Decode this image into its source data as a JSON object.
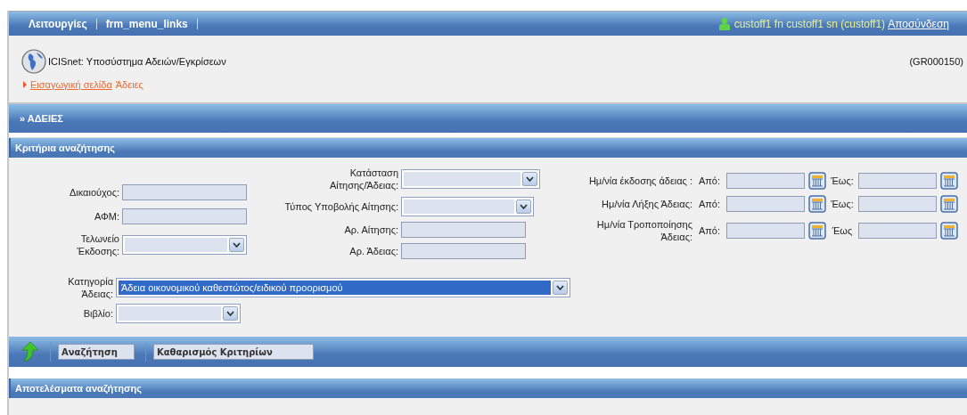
{
  "top_bar": {
    "menu": [
      "Λειτουργίες",
      "frm_menu_links"
    ],
    "user": "custoff1 fn custoff1 sn (custoff1)",
    "logout": "Αποσύνδεση"
  },
  "header": {
    "title": "ICISnet: Υποσύστημα Αδειών/Εγκρίσεων",
    "code": "(GR000150)",
    "breadcrumb": [
      "Εισαγωγική σελίδα",
      "Άδειες"
    ]
  },
  "section": {
    "chevron": "»",
    "title": "ΑΔΕΙΕΣ"
  },
  "criteria": {
    "title": "Κριτήρια αναζήτησης",
    "column_1": [
      {
        "label": "Δικαιούχος:",
        "kind": "text"
      },
      {
        "label": "ΑΦΜ:",
        "kind": "text"
      },
      {
        "label": "Τελωνείο\nΈκδοσης:",
        "kind": "select"
      }
    ],
    "column_2": [
      {
        "label": "Κατάσταση\nΑίτησης/Άδειας:",
        "kind": "select"
      },
      {
        "label": "Τύπος Υποβολής Αίτησης:",
        "kind": "select"
      },
      {
        "label": "Αρ. Αίτησης:",
        "kind": "text"
      },
      {
        "label": "Αρ. Άδειας:",
        "kind": "text"
      }
    ],
    "date_ranges": [
      {
        "label": "Ημ/νία έκδοσης άδειας :",
        "from_label": "Από:",
        "to_label": "Έως:"
      },
      {
        "label": "Ημ/νία Λήξης Άδειας:",
        "from_label": "Από:",
        "to_label": "Έως:"
      },
      {
        "label": "Ημ/νία Τροποποίησης\nΆδειας:",
        "from_label": "Από:",
        "to_label": "Έως"
      }
    ],
    "bottom": [
      {
        "label": "Κατηγορία\nΆδειας:",
        "kind": "select",
        "value": "Άδεια οικονομικού καθεστώτος/ειδικού προορισμού",
        "highlighted": true
      },
      {
        "label": "Βιβλίο:",
        "kind": "select",
        "highlighted": false
      }
    ]
  },
  "toolbar": {
    "buttons": [
      "Αναζήτηση",
      "Καθαρισμός Κριτηρίων"
    ]
  },
  "results": {
    "title": "Αποτελέσματα αναζήτησης"
  }
}
